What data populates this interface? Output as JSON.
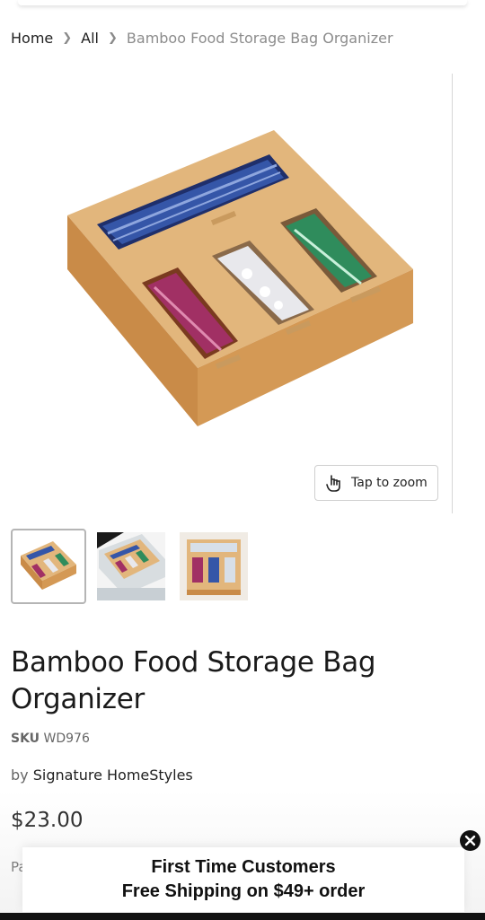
{
  "breadcrumb": {
    "home": "Home",
    "all": "All",
    "current": "Bamboo Food Storage Bag Organizer"
  },
  "gallery": {
    "zoom_label": "Tap to zoom",
    "zoom_icon": "hand-pointer-icon",
    "thumbnails": [
      "thumbnail-1",
      "thumbnail-2",
      "thumbnail-3"
    ]
  },
  "product": {
    "title": "Bamboo Food Storage Bag Organizer",
    "sku_label": "SKU",
    "sku_value": "WD976",
    "vendor_prefix": "by",
    "vendor": "Signature HomeStyles",
    "price": "$23.00",
    "partial_text": "Pa"
  },
  "promo": {
    "line1": "First Time Customers",
    "line2": "Free Shipping on $49+ order",
    "close_icon": "close-icon"
  },
  "colors": {
    "bamboo": "#d9a463",
    "blue_bag": "#2b4a9a",
    "red_bag": "#9c2e5c",
    "green_bag": "#2d8a5a"
  }
}
